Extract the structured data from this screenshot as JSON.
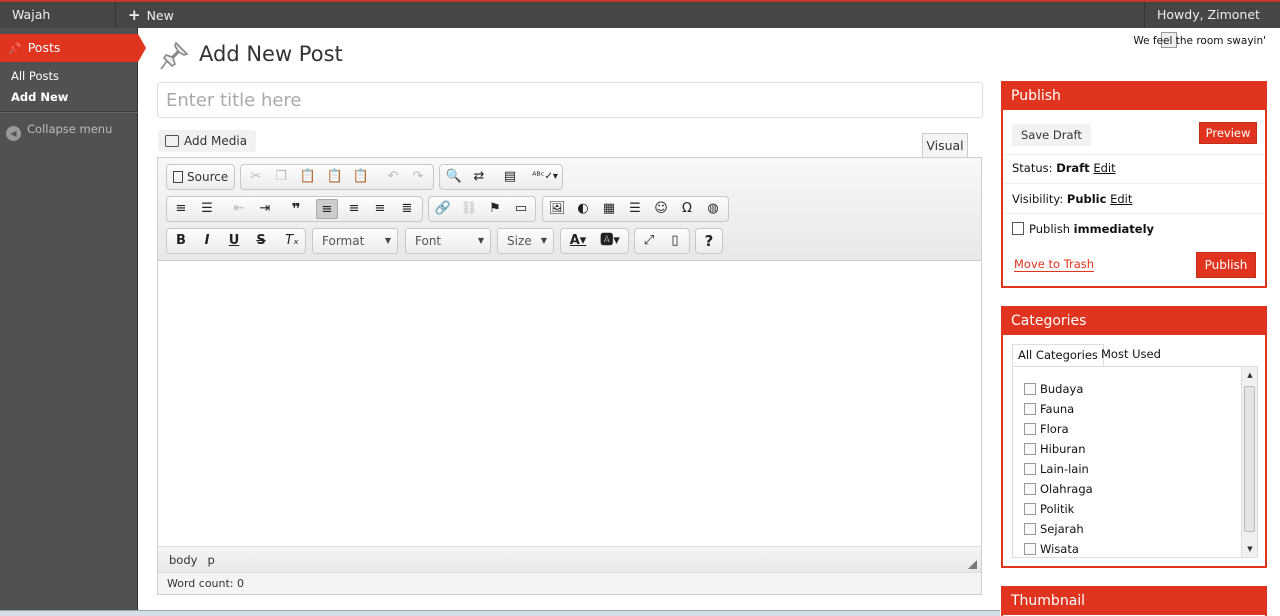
{
  "adminbar": {
    "site_name": "Wajah Indonesia",
    "new_label": "New",
    "howdy": "Howdy, Zimonet"
  },
  "menu": {
    "posts": "Posts",
    "all_posts": "All Posts",
    "add_new": "Add New",
    "collapse": "Collapse menu"
  },
  "header": {
    "title": "Add New Post",
    "tagline": "We feel the room swayin'"
  },
  "post": {
    "title_placeholder": "Enter title here",
    "add_media": "Add Media",
    "visual_tab": "Visual"
  },
  "editor": {
    "source_label": "Source",
    "format_label": "Format",
    "font_label": "Font",
    "size_label": "Size",
    "path": [
      "body",
      "p"
    ],
    "word_count": "Word count: 0"
  },
  "publish": {
    "heading": "Publish",
    "save_draft": "Save Draft",
    "preview": "Preview",
    "status_label": "Status:",
    "status_value": "Draft",
    "visibility_label": "Visibility:",
    "visibility_value": "Public",
    "edit_link": "Edit",
    "publish_label": "Publish",
    "publish_when": "immediately",
    "move_to_trash": "Move to Trash",
    "publish_button": "Publish"
  },
  "categories": {
    "heading": "Categories",
    "tab_all": "All Categories",
    "tab_used": "Most Used",
    "items": [
      "Budaya",
      "Fauna",
      "Flora",
      "Hiburan",
      "Lain-lain",
      "Olahraga",
      "Politik",
      "Sejarah",
      "Wisata"
    ]
  },
  "thumbnail": {
    "heading": "Thumbnail"
  },
  "colors": {
    "accent": "#e1341e",
    "adminbar": "#464646",
    "sidebar": "#515151"
  }
}
